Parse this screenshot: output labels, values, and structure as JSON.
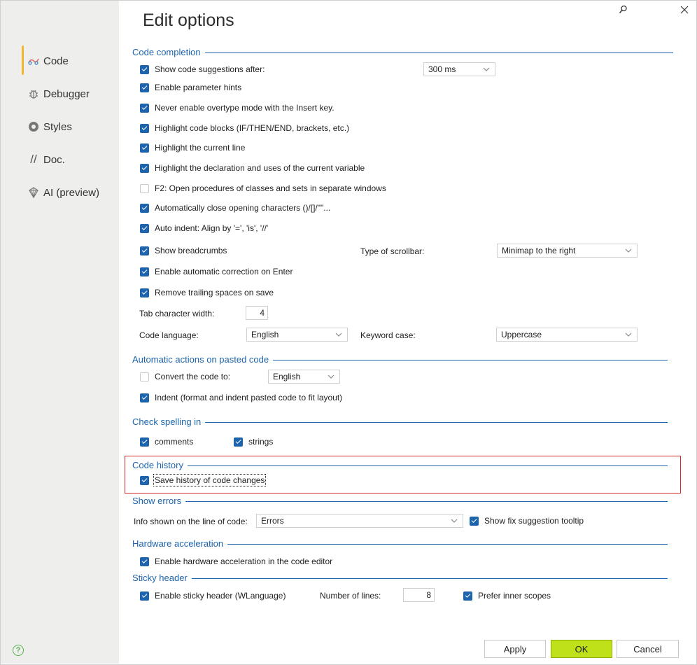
{
  "title": "Edit options",
  "sidebar": {
    "items": [
      {
        "label": "Code",
        "icon": "code-icon",
        "active": true
      },
      {
        "label": "Debugger",
        "icon": "bug-icon"
      },
      {
        "label": "Styles",
        "icon": "styles-icon"
      },
      {
        "label": "Doc.",
        "icon": "doc-slashes-icon"
      },
      {
        "label": "AI (preview)",
        "icon": "ai-icon"
      }
    ],
    "help_icon": "?"
  },
  "sections": {
    "code_completion": "Code completion",
    "pasted": "Automatic actions on pasted code",
    "spelling": "Check spelling in",
    "history": "Code history",
    "errors": "Show errors",
    "hardware": "Hardware acceleration",
    "sticky": "Sticky header"
  },
  "code_completion": {
    "show_suggestions": "Show code suggestions after:",
    "suggestions_delay": "300 ms",
    "param_hints": "Enable parameter hints",
    "overtype": "Never enable overtype mode with the Insert key.",
    "highlight_blocks": "Highlight code blocks (IF/THEN/END, brackets, etc.)",
    "highlight_line": "Highlight the current line",
    "highlight_decl": "Highlight the declaration and uses of the current variable",
    "f2_open": "F2: Open procedures of classes and sets in separate windows",
    "auto_close": "Automatically close opening characters ()/[]/\"\"...",
    "auto_indent": "Auto indent: Align by '=', 'is', '//'",
    "breadcrumbs": "Show breadcrumbs",
    "scrollbar_label": "Type of scrollbar:",
    "scrollbar_value": "Minimap to the right",
    "auto_correction": "Enable automatic correction on Enter",
    "trailing_spaces": "Remove trailing spaces on save",
    "tab_width_label": "Tab character width:",
    "tab_width_value": "4",
    "code_language_label": "Code language:",
    "code_language_value": "English",
    "keyword_case_label": "Keyword case:",
    "keyword_case_value": "Uppercase"
  },
  "pasted": {
    "convert": "Convert the code to:",
    "convert_value": "English",
    "indent": "Indent (format and indent pasted code to fit layout)"
  },
  "spelling": {
    "comments": "comments",
    "strings": "strings"
  },
  "history": {
    "save": "Save history of code changes"
  },
  "errors": {
    "info_label": "Info shown on the line of code:",
    "info_value": "Errors",
    "fix_tooltip": "Show fix suggestion tooltip"
  },
  "hardware": {
    "enable": "Enable hardware acceleration in the code editor"
  },
  "sticky": {
    "enable": "Enable sticky header (WLanguage)",
    "lines_label": "Number of lines:",
    "lines_value": "8",
    "inner_scopes": "Prefer inner scopes"
  },
  "buttons": {
    "apply": "Apply",
    "ok": "OK",
    "cancel": "Cancel"
  },
  "colors": {
    "accent": "#1d64ad",
    "ok_button": "#bfe11a",
    "highlight_box": "#d62828",
    "active_nav": "#f2b632"
  }
}
